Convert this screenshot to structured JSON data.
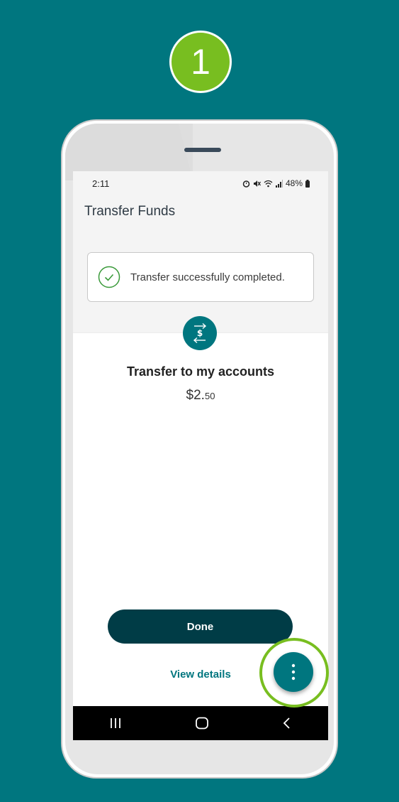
{
  "step": {
    "number": "1"
  },
  "status_bar": {
    "time": "2:11",
    "battery": "48%",
    "icons": [
      "alarm-icon",
      "mute-icon",
      "wifi-icon",
      "signal-icon",
      "battery-icon"
    ]
  },
  "header": {
    "title": "Transfer Funds"
  },
  "notification": {
    "message": "Transfer successfully completed.",
    "icon": "check-circle-icon"
  },
  "transfer": {
    "icon": "transfer-dollar-icon",
    "heading": "Transfer to my accounts",
    "amount_dollars": "$2.",
    "amount_cents": "50"
  },
  "actions": {
    "done_label": "Done",
    "view_details_label": "View details",
    "more_icon": "more-vertical-icon"
  },
  "nav": {
    "icons": [
      "recent-apps-icon",
      "home-icon",
      "back-icon"
    ]
  },
  "colors": {
    "background": "#00767f",
    "accent_green": "#78be20",
    "primary_dark": "#003c46",
    "link": "#00767f"
  }
}
